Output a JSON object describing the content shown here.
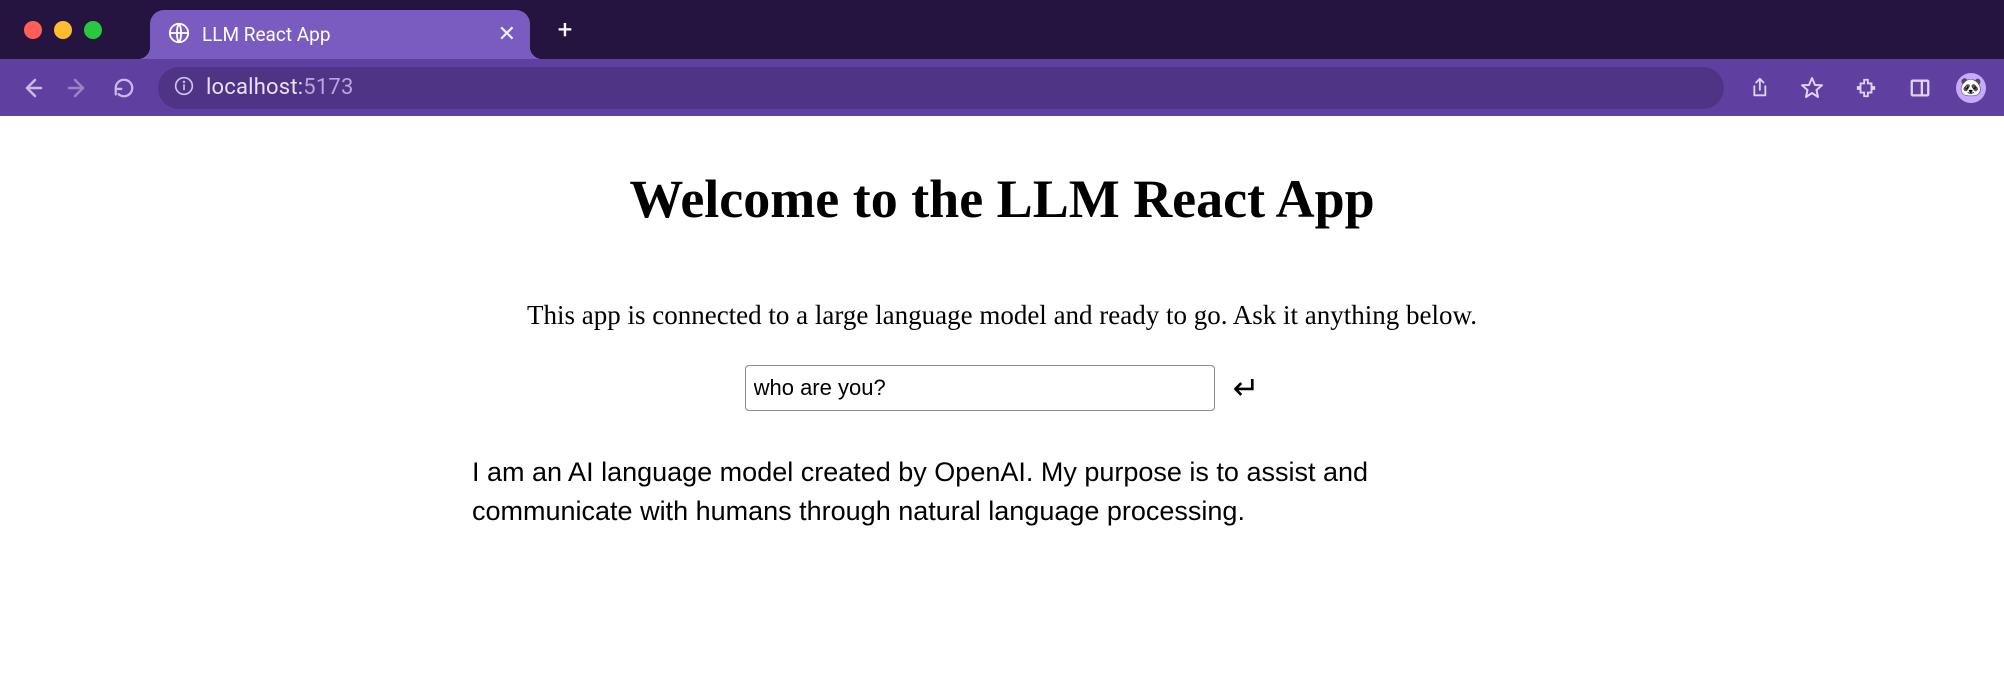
{
  "browser": {
    "tab_title": "LLM React App",
    "address_host": "localhost:",
    "address_port": "5173"
  },
  "page": {
    "heading": "Welcome to the LLM React App",
    "subtitle": "This app is connected to a large language model and ready to go. Ask it anything below.",
    "input_value": "who are you?",
    "submit_glyph": "↵",
    "response": "I am an AI language model created by OpenAI. My purpose is to assist and communicate with humans through natural language processing."
  },
  "icons": {
    "close": "✕",
    "plus": "+",
    "avatar": "🐼"
  }
}
